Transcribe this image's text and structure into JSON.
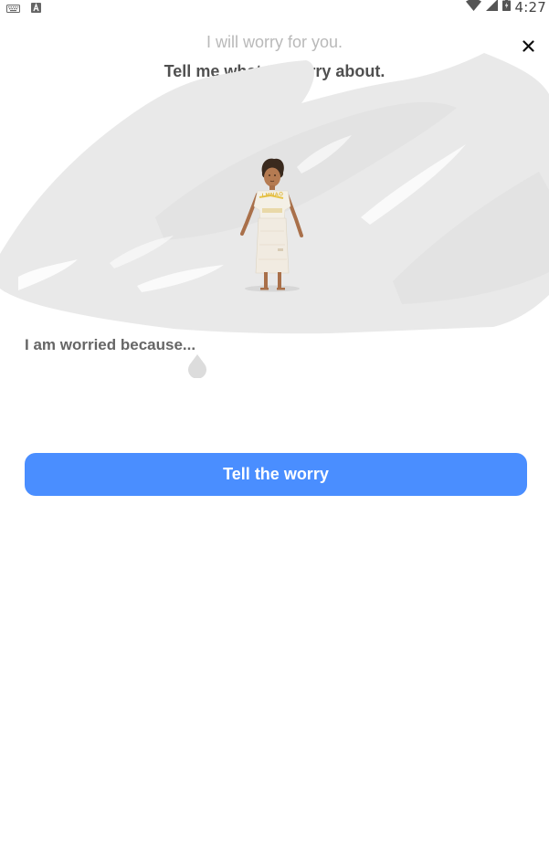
{
  "status_bar": {
    "time": "4:27",
    "keyboard_icon": "keyboard-icon",
    "notification_icon": "a-letter-icon",
    "wifi_icon": "wifi-icon",
    "signal_icon": "signal-icon",
    "battery_icon": "battery-icon"
  },
  "header": {
    "subtitle": "I will worry for you.",
    "title": "Tell me what to worry about.",
    "close_icon": "close-icon"
  },
  "illustration": {
    "icon": "worry-character-illustration",
    "shirt_text": "LMNAO"
  },
  "input": {
    "placeholder": "I am worried because...",
    "value": ""
  },
  "primary_button": {
    "label": "Tell the worry"
  },
  "colors": {
    "accent": "#4a8eff",
    "subtitle_text": "#b9b9b9",
    "title_text": "#505050",
    "wash": "#e9e9e9"
  }
}
